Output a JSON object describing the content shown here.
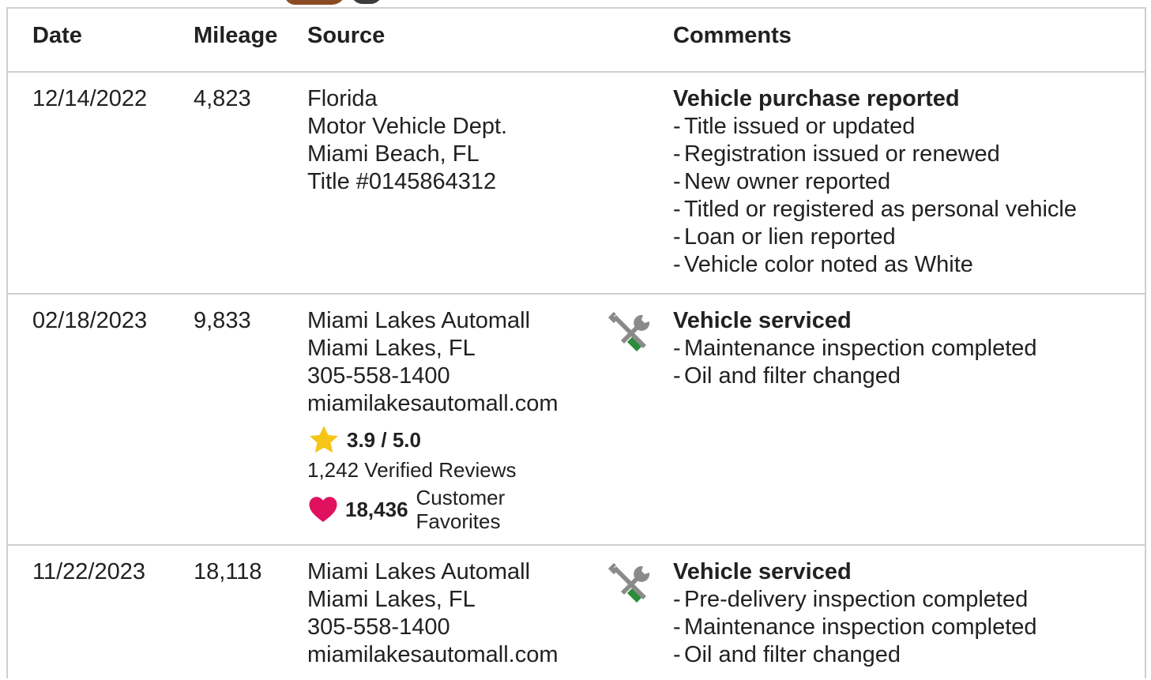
{
  "headers": {
    "date": "Date",
    "mileage": "Mileage",
    "source": "Source",
    "comments": "Comments"
  },
  "records": [
    {
      "date": "12/14/2022",
      "mileage": "4,823",
      "source": [
        "Florida",
        "Motor Vehicle Dept.",
        "Miami Beach, FL",
        "Title #0145864312"
      ],
      "comment_title": "Vehicle purchase reported",
      "comment_items": [
        "Title issued or updated",
        "Registration issued or renewed",
        "New owner reported",
        "Titled or registered as personal vehicle",
        "Loan or lien reported",
        "Vehicle color noted as White"
      ]
    },
    {
      "date": "02/18/2023",
      "mileage": "9,833",
      "source": [
        "Miami Lakes Automall",
        "Miami Lakes, FL",
        "305-558-1400",
        "miamilakesautomall.com"
      ],
      "icon": "service-tools-icon",
      "rating": "3.9 / 5.0",
      "reviews": "1,242 Verified Reviews",
      "favorites_count": "18,436",
      "favorites_label": [
        "Customer",
        "Favorites"
      ],
      "comment_title": "Vehicle serviced",
      "comment_items": [
        "Maintenance inspection completed",
        "Oil and filter changed"
      ]
    },
    {
      "date": "11/22/2023",
      "mileage": "18,118",
      "source": [
        "Miami Lakes Automall",
        "Miami Lakes, FL",
        "305-558-1400",
        "miamilakesautomall.com"
      ],
      "icon": "service-tools-icon",
      "comment_title": "Vehicle serviced",
      "comment_items": [
        "Pre-delivery inspection completed",
        "Maintenance inspection completed",
        "Oil and filter changed"
      ]
    }
  ],
  "colors": {
    "border": "#cfcfcf",
    "text": "#212121",
    "star": "#f5c518",
    "heart": "#e0125f",
    "wrench_gray": "#8a8a8a",
    "screwdriver_green": "#2e8b3a"
  },
  "dash": "-"
}
